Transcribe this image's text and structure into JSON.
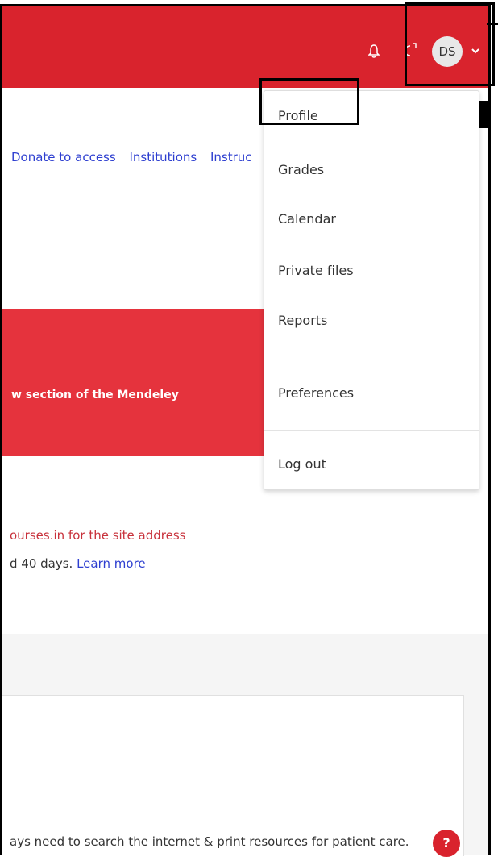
{
  "header": {
    "user_initials": "DS",
    "brand_color": "#d9232d"
  },
  "nav": {
    "items": [
      "Donate to access",
      "Institutions",
      "Instruc"
    ]
  },
  "banner": {
    "text": "w section of the Mendeley"
  },
  "notice": {
    "red_line": "ourses.in for the site address",
    "black_line_prefix": "d 40 days. ",
    "learn_more": "Learn more"
  },
  "card": {
    "text": "ays need to search the internet & print resources for patient care."
  },
  "help": {
    "label": "?"
  },
  "user_menu": {
    "items": [
      "Profile",
      "Grades",
      "Calendar",
      "Private files",
      "Reports",
      "Preferences",
      "Log out"
    ]
  },
  "icons": {
    "bell": "bell-icon",
    "messages": "messages-icon",
    "caret": "chevron-down-icon",
    "help": "help-icon"
  }
}
